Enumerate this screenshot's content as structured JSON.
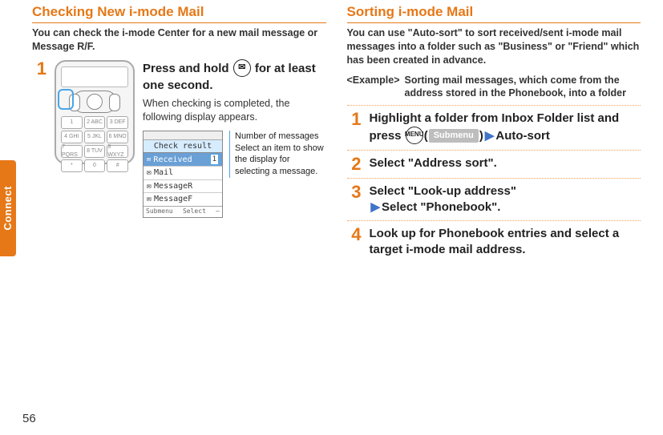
{
  "sideTab": "Connect",
  "pageNumber": "56",
  "left": {
    "heading": "Checking New i-mode Mail",
    "intro": "You can check the i-mode Center for a new mail message or Message R/F.",
    "step1": {
      "num": "1",
      "title_a": "Press and hold ",
      "title_b": " for at least one second.",
      "sub": "When checking is completed, the following display appears."
    },
    "result": {
      "title": "Check result",
      "rowSel": "Received",
      "count": "1",
      "row2": "Mail",
      "row3": "MessageR",
      "row4": "MessageF",
      "soft_l": "Submenu",
      "soft_c": "Select",
      "soft_r": "—"
    },
    "callout": {
      "line1": "Number of messages",
      "line2": "Select an item to show the display for selecting a message."
    },
    "keypad": [
      "1",
      "2 ABC",
      "3 DEF",
      "4 GHI",
      "5 JKL",
      "6 MNO",
      "7 PQRS",
      "8 TUV",
      "9 WXYZ",
      "*",
      "0",
      "#"
    ]
  },
  "right": {
    "heading": "Sorting i-mode Mail",
    "intro": "You can use \"Auto-sort\" to sort received/sent i-mode mail messages into a folder such as \"Business\" or \"Friend\" which has been created in advance.",
    "example_label": "<Example>",
    "example_text": "Sorting mail messages, which come from the address stored in the Phonebook, into a folder",
    "step1": {
      "num": "1",
      "text_a": "Highlight a folder from Inbox Folder list and press ",
      "menu": "MENU",
      "submenu": "Submenu",
      "text_b": "Auto-sort"
    },
    "step2": {
      "num": "2",
      "text": "Select \"Address sort\"."
    },
    "step3": {
      "num": "3",
      "text_a": "Select \"Look-up address\"",
      "text_b": "Select \"Phonebook\"."
    },
    "step4": {
      "num": "4",
      "text": "Look up for Phonebook entries and select a target i-mode mail address."
    }
  }
}
